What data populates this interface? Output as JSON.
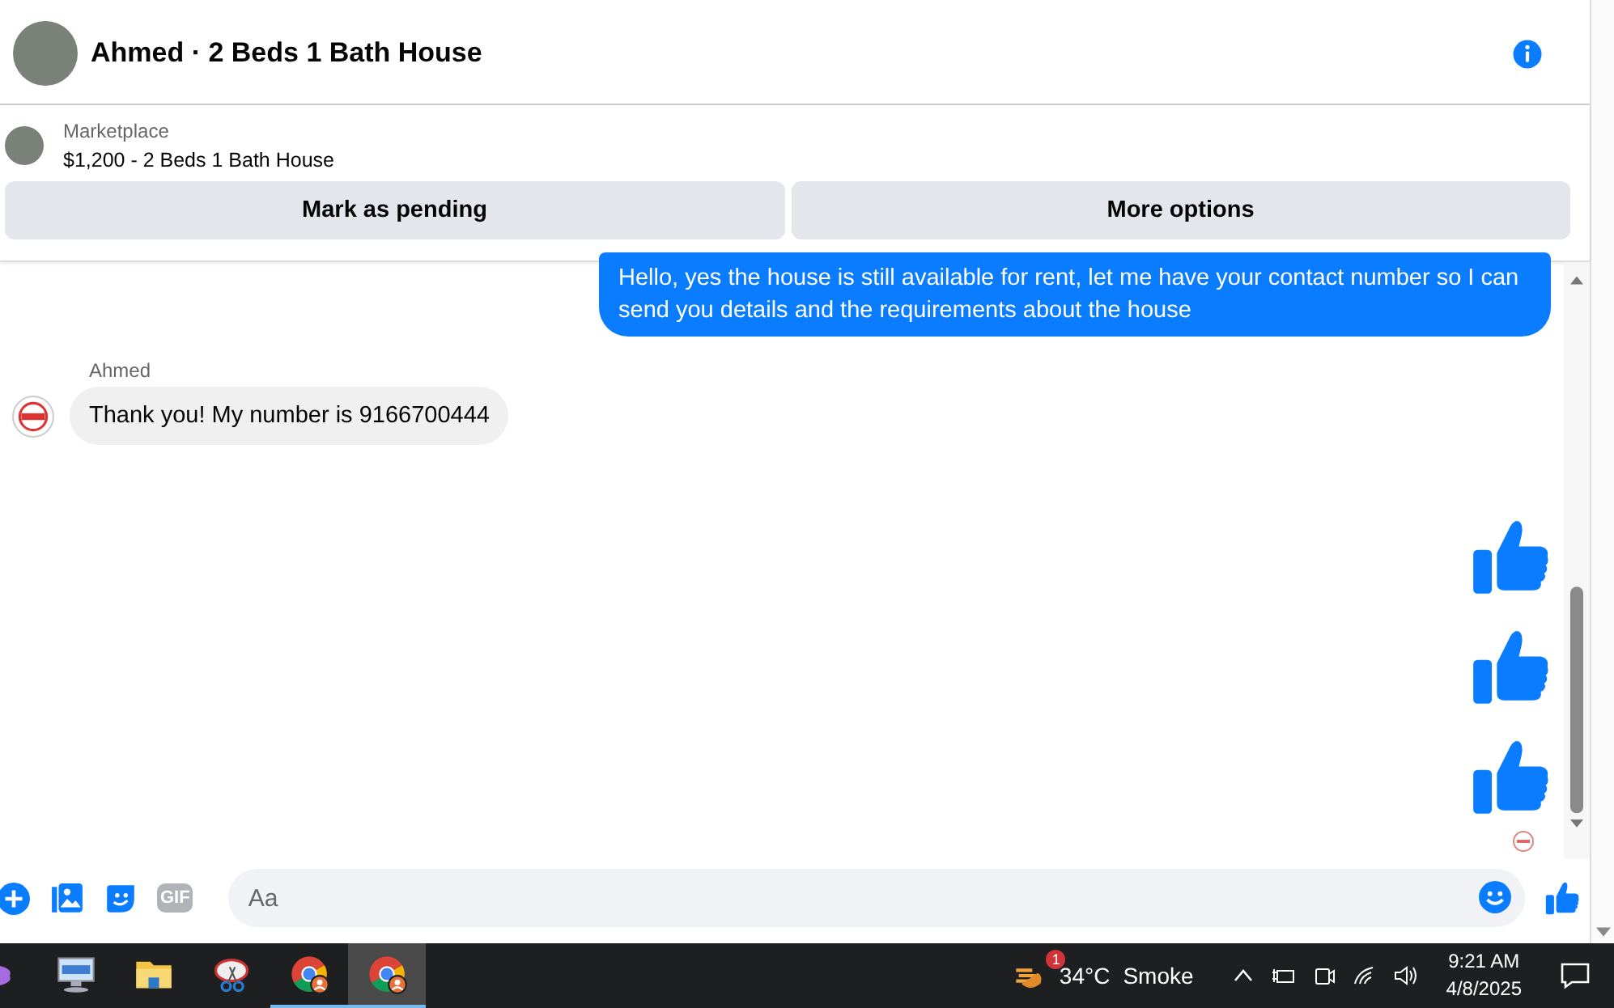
{
  "header": {
    "title": "Ahmed · 2 Beds 1 Bath House"
  },
  "listing": {
    "label": "Marketplace",
    "title": "$1,200 - 2 Beds 1 Bath House"
  },
  "actions": [
    "Mark as pending",
    "More options"
  ],
  "messages": [
    {
      "kind": "outgoing",
      "text": "Hello, yes the house is still available for rent, let me have your contact number so I can send you details and the requirements about the house"
    },
    {
      "kind": "incoming",
      "sender": "Ahmed",
      "text": "Thank you! My number is 9166700444"
    },
    {
      "kind": "like"
    },
    {
      "kind": "like"
    },
    {
      "kind": "like"
    }
  ],
  "composer": {
    "placeholder": "Aa",
    "gif": "GIF"
  },
  "taskbar": {
    "apps": [
      {
        "kind": "remote",
        "open": false,
        "selected": false
      },
      {
        "kind": "folder",
        "open": false,
        "selected": false
      },
      {
        "kind": "snip",
        "open": false,
        "selected": false
      },
      {
        "kind": "chrome",
        "open": true,
        "selected": false
      },
      {
        "kind": "chrome",
        "open": true,
        "selected": true
      }
    ],
    "weather": {
      "badge": "1",
      "temperature": "34°C",
      "condition": "Smoke"
    },
    "time": "9:21 AM",
    "date": "4/8/2025"
  }
}
